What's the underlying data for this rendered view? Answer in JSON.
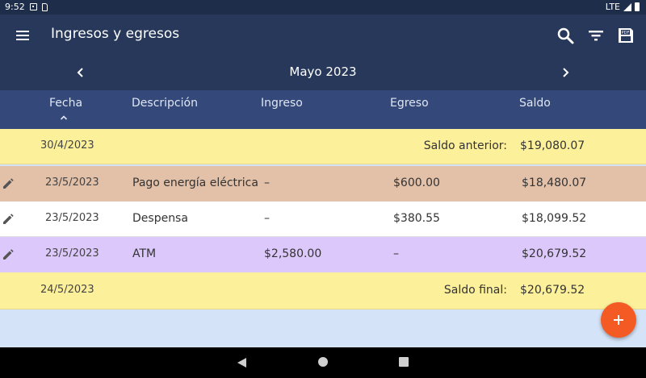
{
  "status_bar": {
    "time": "9:52",
    "network": "LTE"
  },
  "app_bar": {
    "title": "Ingresos y egresos"
  },
  "month_nav": {
    "label": "Mayo 2023"
  },
  "columns": {
    "fecha": "Fecha",
    "descripcion": "Descripción",
    "ingreso": "Ingreso",
    "egreso": "Egreso",
    "saldo": "Saldo"
  },
  "opening": {
    "date": "30/4/2023",
    "label": "Saldo anterior:",
    "value": "$19,080.07"
  },
  "rows": [
    {
      "date": "23/5/2023",
      "description": "Pago energía eléctrica",
      "ingreso": "–",
      "egreso": "$600.00",
      "saldo": "$18,480.07"
    },
    {
      "date": "23/5/2023",
      "description": "Despensa",
      "ingreso": "–",
      "egreso": "$380.55",
      "saldo": "$18,099.52"
    },
    {
      "date": "23/5/2023",
      "description": "ATM",
      "ingreso": "$2,580.00",
      "egreso": "–",
      "saldo": "$20,679.52"
    }
  ],
  "closing": {
    "date": "24/5/2023",
    "label": "Saldo final:",
    "value": "$20,679.52"
  },
  "colors": {
    "app_bar": "#27385a",
    "header": "#34497a",
    "summary_row": "#fdf09a",
    "expense_row": "#e3c0a8",
    "income_row": "#dcc8fb",
    "fab": "#f45a24",
    "background": "#d4e3f7"
  },
  "icons": [
    "menu-icon",
    "search-icon",
    "filter-icon",
    "pdf-icon",
    "chevron-left-icon",
    "chevron-right-icon",
    "sort-up-icon",
    "edit-icon",
    "add-icon"
  ]
}
